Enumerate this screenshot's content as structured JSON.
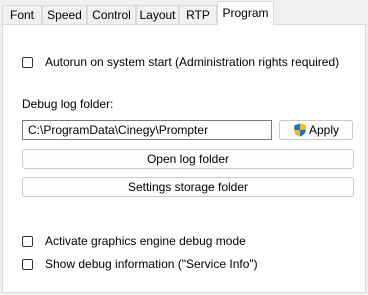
{
  "tabs": [
    "Font",
    "Speed",
    "Control",
    "Layout",
    "RTP",
    "Program"
  ],
  "active_tab": "Program",
  "autorun": {
    "label": "Autorun on system start  (Administration rights required)",
    "checked": false
  },
  "debug_folder": {
    "label": "Debug log folder:",
    "value": "C:\\ProgramData\\Cinegy\\Prompter",
    "apply_label": "Apply"
  },
  "buttons": {
    "open_log_folder": "Open log folder",
    "settings_storage_folder": "Settings storage folder"
  },
  "graphics_debug": {
    "label": "Activate graphics engine debug mode",
    "checked": false
  },
  "service_info": {
    "label": "Show debug information (\"Service Info\")",
    "checked": false
  },
  "icons": {
    "apply": "uac-shield-icon"
  }
}
